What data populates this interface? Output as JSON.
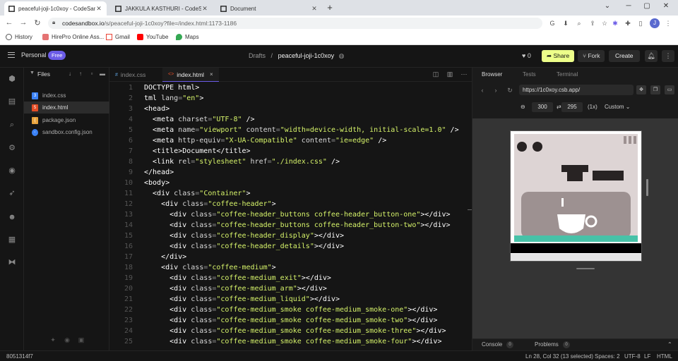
{
  "browser": {
    "tabs": [
      {
        "title": "peaceful-joji-1c0xoy - CodeSandbox",
        "icon": "codesandbox-icon"
      },
      {
        "title": "JAKKULA KASTHURI - CodeSandbox",
        "icon": "codesandbox-icon"
      },
      {
        "title": "Document",
        "icon": "codesandbox-icon"
      }
    ],
    "new_tab": "+",
    "window_controls": {
      "minimize": "─",
      "maximize": "▢",
      "close": "✕"
    },
    "url_host": "codesandbox.io",
    "url_path": "/s/peaceful-joji-1c0xoy?file=/index.html:1173-1186",
    "profile_initial": "J",
    "bookmarks": [
      {
        "label": "History",
        "icon": "history-icon",
        "color": "#555555"
      },
      {
        "label": "HirePro Online Ass...",
        "icon": "hirepro-icon",
        "color": "#e57373"
      },
      {
        "label": "Gmail",
        "icon": "gmail-icon",
        "color": "#ea4335"
      },
      {
        "label": "YouTube",
        "icon": "youtube-icon",
        "color": "#ff0000"
      },
      {
        "label": "Maps",
        "icon": "maps-icon",
        "color": "#34a853"
      }
    ]
  },
  "header": {
    "workspace": "Personal",
    "plan_badge": "Free",
    "breadcrumb_folder": "Drafts",
    "breadcrumb_sep": "/",
    "project_name": "peaceful-joji-1c0xoy",
    "likes": "0",
    "share_label": "Share",
    "fork_label": "Fork",
    "create_label": "Create",
    "accent_color": "#edff8a",
    "brand_color": "#6b5ce7"
  },
  "explorer": {
    "title": "Files",
    "files": [
      {
        "name": "index.css",
        "icon": "css-file-icon",
        "color": "#3b82f6",
        "selected": false
      },
      {
        "name": "index.html",
        "icon": "html-file-icon",
        "color": "#e44d26",
        "selected": true
      },
      {
        "name": "package.json",
        "icon": "json-file-icon",
        "color": "#e8a33d",
        "selected": false
      },
      {
        "name": "sandbox.config.json",
        "icon": "config-file-icon",
        "color": "#3b82f6",
        "selected": false
      }
    ]
  },
  "editor": {
    "tabs": [
      {
        "label": "index.css",
        "icon": "#",
        "active": false
      },
      {
        "label": "index.html",
        "icon": "<>",
        "active": true
      }
    ],
    "close_glyph": "×",
    "lines": [
      {
        "n": "1",
        "parts": [
          [
            "tg",
            "DOCTYPE html>"
          ]
        ]
      },
      {
        "n": "2",
        "parts": [
          [
            "tg",
            "tml "
          ],
          [
            "at",
            "lang"
          ],
          [
            "pu",
            "="
          ],
          [
            "st",
            "\"en\""
          ],
          [
            "tg",
            ">"
          ]
        ]
      },
      {
        "n": "3",
        "parts": [
          [
            "tg",
            "<head>"
          ]
        ]
      },
      {
        "n": "4",
        "parts": [
          [
            "tg",
            "  <meta "
          ],
          [
            "at",
            "charset"
          ],
          [
            "pu",
            "="
          ],
          [
            "st",
            "\"UTF-8\""
          ],
          [
            "tg",
            " />"
          ]
        ]
      },
      {
        "n": "5",
        "parts": [
          [
            "tg",
            "  <meta "
          ],
          [
            "at",
            "name"
          ],
          [
            "pu",
            "="
          ],
          [
            "st",
            "\"viewport\""
          ],
          [
            "at",
            " content"
          ],
          [
            "pu",
            "="
          ],
          [
            "st",
            "\"width=device-width, initial-scale=1.0\""
          ],
          [
            "tg",
            " />"
          ]
        ]
      },
      {
        "n": "6",
        "parts": [
          [
            "tg",
            "  <meta "
          ],
          [
            "at",
            "http-equiv"
          ],
          [
            "pu",
            "="
          ],
          [
            "st",
            "\"X-UA-Compatible\""
          ],
          [
            "at",
            " content"
          ],
          [
            "pu",
            "="
          ],
          [
            "st",
            "\"ie=edge\""
          ],
          [
            "tg",
            " />"
          ]
        ]
      },
      {
        "n": "7",
        "parts": [
          [
            "tg",
            "  <title>"
          ],
          [
            "tg",
            "Document"
          ],
          [
            "tg",
            "</title>"
          ]
        ]
      },
      {
        "n": "8",
        "parts": [
          [
            "tg",
            "  <link "
          ],
          [
            "at",
            "rel"
          ],
          [
            "pu",
            "="
          ],
          [
            "st",
            "\"stylesheet\""
          ],
          [
            "at",
            " href"
          ],
          [
            "pu",
            "="
          ],
          [
            "st",
            "\"./index.css\""
          ],
          [
            "tg",
            " />"
          ]
        ]
      },
      {
        "n": "9",
        "parts": [
          [
            "tg",
            "</head>"
          ]
        ]
      },
      {
        "n": "10",
        "parts": [
          [
            "tg",
            "<body>"
          ]
        ]
      },
      {
        "n": "11",
        "parts": [
          [
            "tg",
            "  <div "
          ],
          [
            "at",
            "class"
          ],
          [
            "pu",
            "="
          ],
          [
            "st",
            "\"Container\""
          ],
          [
            "tg",
            ">"
          ]
        ]
      },
      {
        "n": "12",
        "parts": [
          [
            "tg",
            "    <div "
          ],
          [
            "at",
            "class"
          ],
          [
            "pu",
            "="
          ],
          [
            "st",
            "\"coffee-header\""
          ],
          [
            "tg",
            ">"
          ]
        ]
      },
      {
        "n": "13",
        "parts": [
          [
            "tg",
            "      <div "
          ],
          [
            "at",
            "class"
          ],
          [
            "pu",
            "="
          ],
          [
            "st",
            "\"coffee-header_buttons coffee-header_button-one\""
          ],
          [
            "tg",
            "></div>"
          ]
        ]
      },
      {
        "n": "14",
        "parts": [
          [
            "tg",
            "      <div "
          ],
          [
            "at",
            "class"
          ],
          [
            "pu",
            "="
          ],
          [
            "st",
            "\"coffee-header_buttons coffee-header_button-two\""
          ],
          [
            "tg",
            "></div>"
          ]
        ]
      },
      {
        "n": "15",
        "parts": [
          [
            "tg",
            "      <div "
          ],
          [
            "at",
            "class"
          ],
          [
            "pu",
            "="
          ],
          [
            "st",
            "\"coffee-header_display\""
          ],
          [
            "tg",
            "></div>"
          ]
        ]
      },
      {
        "n": "16",
        "parts": [
          [
            "tg",
            "      <div "
          ],
          [
            "at",
            "class"
          ],
          [
            "pu",
            "="
          ],
          [
            "st",
            "\"coffee-header_details\""
          ],
          [
            "tg",
            "></div>"
          ]
        ]
      },
      {
        "n": "17",
        "parts": [
          [
            "tg",
            "    </div>"
          ]
        ]
      },
      {
        "n": "18",
        "parts": [
          [
            "tg",
            "    <div "
          ],
          [
            "at",
            "class"
          ],
          [
            "pu",
            "="
          ],
          [
            "st",
            "\"coffee-medium\""
          ],
          [
            "tg",
            ">"
          ]
        ]
      },
      {
        "n": "19",
        "parts": [
          [
            "tg",
            "      <div "
          ],
          [
            "at",
            "class"
          ],
          [
            "pu",
            "="
          ],
          [
            "st",
            "\"coffee-medium_exit\""
          ],
          [
            "tg",
            "></div>"
          ]
        ]
      },
      {
        "n": "20",
        "parts": [
          [
            "tg",
            "      <div "
          ],
          [
            "at",
            "class"
          ],
          [
            "pu",
            "="
          ],
          [
            "st",
            "\"coffee-medium_arm\""
          ],
          [
            "tg",
            "></div>"
          ]
        ]
      },
      {
        "n": "21",
        "parts": [
          [
            "tg",
            "      <div "
          ],
          [
            "at",
            "class"
          ],
          [
            "pu",
            "="
          ],
          [
            "st",
            "\"coffee-medium_liquid\""
          ],
          [
            "tg",
            "></div>"
          ]
        ]
      },
      {
        "n": "22",
        "parts": [
          [
            "tg",
            "      <div "
          ],
          [
            "at",
            "class"
          ],
          [
            "pu",
            "="
          ],
          [
            "st",
            "\"coffee-medium_smoke coffee-medium_smoke-one\""
          ],
          [
            "tg",
            "></div>"
          ]
        ]
      },
      {
        "n": "23",
        "parts": [
          [
            "tg",
            "      <div "
          ],
          [
            "at",
            "class"
          ],
          [
            "pu",
            "="
          ],
          [
            "st",
            "\"coffee-medium_smoke coffee-medium_smoke-two\""
          ],
          [
            "tg",
            "></div>"
          ]
        ]
      },
      {
        "n": "24",
        "parts": [
          [
            "tg",
            "      <div "
          ],
          [
            "at",
            "class"
          ],
          [
            "pu",
            "="
          ],
          [
            "st",
            "\"coffee-medium_smoke coffee-medium_smoke-three\""
          ],
          [
            "tg",
            "></div>"
          ]
        ]
      },
      {
        "n": "25",
        "parts": [
          [
            "tg",
            "      <div "
          ],
          [
            "at",
            "class"
          ],
          [
            "pu",
            "="
          ],
          [
            "st",
            "\"coffee-medium_smoke coffee-medium_smoke-four\""
          ],
          [
            "tg",
            "></div>"
          ]
        ]
      }
    ]
  },
  "preview": {
    "tabs": [
      "Browser",
      "Tests",
      "Terminal"
    ],
    "url": "https://1c0xoy.csb.app/",
    "width": "300",
    "height": "295",
    "dim_sep": "⇄",
    "zoom": "(1x)",
    "device": "Custom",
    "console_label": "Console",
    "console_count": "0",
    "problems_label": "Problems",
    "problems_count": "0",
    "machine_colors": {
      "body": "#ddd4d4",
      "dark": "#282323",
      "window": "#9d9191",
      "tray": "#47c2a8"
    }
  },
  "status": {
    "commit": "8051314f7",
    "cursor": "Ln 28, Col 32 (13 selected)",
    "spaces": "Spaces: 2",
    "encoding": "UTF-8",
    "eol": "LF",
    "language": "HTML"
  }
}
